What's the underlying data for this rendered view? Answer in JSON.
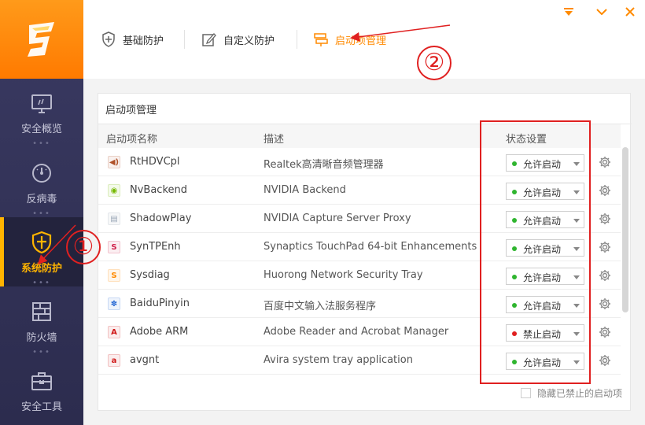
{
  "sidebar": {
    "logo": "huorong-logo",
    "items": [
      {
        "label": "安全概览",
        "icon": "monitor-icon",
        "active": false
      },
      {
        "label": "反病毒",
        "icon": "gauge-icon",
        "active": false
      },
      {
        "label": "系统防护",
        "icon": "shield-icon",
        "active": true
      },
      {
        "label": "防火墙",
        "icon": "firewall-icon",
        "active": false
      },
      {
        "label": "安全工具",
        "icon": "toolbox-icon",
        "active": false
      }
    ],
    "dots": "•••"
  },
  "window": {
    "minimize_icon": "dropdown-arrow-icon",
    "close_icon": "close-icon"
  },
  "tabs": [
    {
      "label": "基础防护",
      "icon": "shield-plus-icon",
      "active": false
    },
    {
      "label": "自定义防护",
      "icon": "edit-icon",
      "active": false
    },
    {
      "label": "启动项管理",
      "icon": "signpost-icon",
      "active": true
    }
  ],
  "panel": {
    "title": "启动项管理",
    "columns": {
      "name": "启动项名称",
      "desc": "描述",
      "status": "状态设置"
    },
    "rows": [
      {
        "name": "RtHDVCpl",
        "desc": "Realtek高清晰音频管理器",
        "status": "允许启动",
        "status_color": "#2fb52f",
        "icon": "speaker-icon",
        "icon_color": "#b0522a"
      },
      {
        "name": "NvBackend",
        "desc": "NVIDIA Backend",
        "status": "允许启动",
        "status_color": "#2fb52f",
        "icon": "nvidia-icon",
        "icon_color": "#76b900"
      },
      {
        "name": "ShadowPlay",
        "desc": "NVIDIA Capture Server Proxy",
        "status": "允许启动",
        "status_color": "#2fb52f",
        "icon": "file-icon",
        "icon_color": "#9aa6b6"
      },
      {
        "name": "SynTPEnh",
        "desc": "Synaptics TouchPad 64-bit Enhancements",
        "status": "允许启动",
        "status_color": "#2fb52f",
        "icon": "synaptics-icon",
        "icon_color": "#d0204a"
      },
      {
        "name": "Sysdiag",
        "desc": "Huorong Network Security Tray",
        "status": "允许启动",
        "status_color": "#2fb52f",
        "icon": "huorong-icon",
        "icon_color": "#ff8a00"
      },
      {
        "name": "BaiduPinyin",
        "desc": "百度中文输入法服务程序",
        "status": "允许启动",
        "status_color": "#2fb52f",
        "icon": "baidu-icon",
        "icon_color": "#2f6fd6"
      },
      {
        "name": "Adobe ARM",
        "desc": "Adobe Reader and Acrobat Manager",
        "status": "禁止启动",
        "status_color": "#e02020",
        "icon": "adobe-icon",
        "icon_color": "#d01818"
      },
      {
        "name": "avgnt",
        "desc": "Avira system tray application",
        "status": "允许启动",
        "status_color": "#2fb52f",
        "icon": "avira-icon",
        "icon_color": "#d01818"
      }
    ],
    "hide_disabled_label": "隐藏已禁止的启动项"
  },
  "annotations": {
    "circle_1": "①",
    "circle_2": "②",
    "accent_color": "#e02020"
  }
}
